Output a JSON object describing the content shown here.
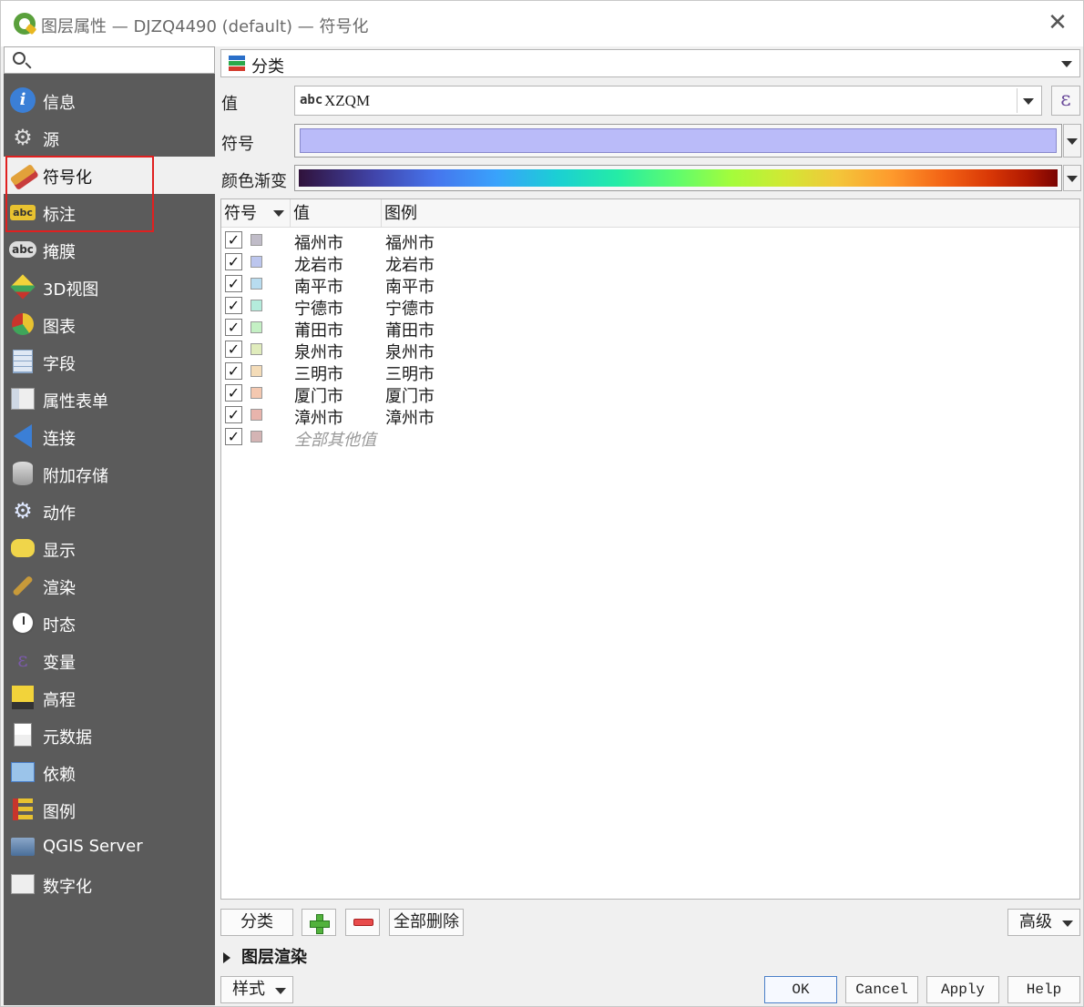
{
  "window": {
    "title": "图层属性 — DJZQ4490 (default) — 符号化",
    "close_glyph": "✕"
  },
  "search": {
    "placeholder": ""
  },
  "sidebar": {
    "items": [
      {
        "label": "信息",
        "icon": "info-icon",
        "selected": false
      },
      {
        "label": "源",
        "icon": "source-wrench-icon",
        "selected": false
      },
      {
        "label": "符号化",
        "icon": "symbology-brush-icon",
        "selected": true
      },
      {
        "label": "标注",
        "icon": "labels-abc-icon",
        "selected": false
      },
      {
        "label": "掩膜",
        "icon": "mask-abc-icon",
        "selected": false
      },
      {
        "label": "3D视图",
        "icon": "3d-cube-icon",
        "selected": false
      },
      {
        "label": "图表",
        "icon": "diagram-icon",
        "selected": false
      },
      {
        "label": "字段",
        "icon": "fields-icon",
        "selected": false
      },
      {
        "label": "属性表单",
        "icon": "attribute-form-icon",
        "selected": false
      },
      {
        "label": "连接",
        "icon": "joins-icon",
        "selected": false
      },
      {
        "label": "附加存储",
        "icon": "auxiliary-storage-icon",
        "selected": false
      },
      {
        "label": "动作",
        "icon": "actions-icon",
        "selected": false
      },
      {
        "label": "显示",
        "icon": "display-tip-icon",
        "selected": false
      },
      {
        "label": "渲染",
        "icon": "rendering-brush-icon",
        "selected": false
      },
      {
        "label": "时态",
        "icon": "temporal-clock-icon",
        "selected": false
      },
      {
        "label": "变量",
        "icon": "variables-epsilon-icon",
        "selected": false
      },
      {
        "label": "高程",
        "icon": "elevation-icon",
        "selected": false
      },
      {
        "label": "元数据",
        "icon": "metadata-icon",
        "selected": false
      },
      {
        "label": "依赖",
        "icon": "dependencies-icon",
        "selected": false
      },
      {
        "label": "图例",
        "icon": "legend-icon",
        "selected": false
      },
      {
        "label": "QGIS Server",
        "icon": "qgis-server-icon",
        "selected": false
      },
      {
        "label": "数字化",
        "icon": "digitizing-icon",
        "selected": false
      }
    ]
  },
  "renderer": {
    "label": "分类"
  },
  "value": {
    "label": "值",
    "type_prefix": "abc",
    "field": "XZQM",
    "expression_glyph": "ε"
  },
  "symbol": {
    "label": "符号",
    "color": "#babbf9"
  },
  "color_ramp": {
    "label": "颜色渐变"
  },
  "table": {
    "headers": {
      "symbol": "符号",
      "value": "值",
      "legend": "图例"
    },
    "check_glyph": "✓",
    "rows": [
      {
        "value": "福州市",
        "legend": "福州市",
        "color": "#c0bcc8",
        "checked": true
      },
      {
        "value": "龙岩市",
        "legend": "龙岩市",
        "color": "#bcc6ee",
        "checked": true
      },
      {
        "value": "南平市",
        "legend": "南平市",
        "color": "#b8dcf0",
        "checked": true
      },
      {
        "value": "宁德市",
        "legend": "宁德市",
        "color": "#b4ecdc",
        "checked": true
      },
      {
        "value": "莆田市",
        "legend": "莆田市",
        "color": "#c4f0c4",
        "checked": true
      },
      {
        "value": "泉州市",
        "legend": "泉州市",
        "color": "#e0ecbc",
        "checked": true
      },
      {
        "value": "三明市",
        "legend": "三明市",
        "color": "#f4dcb8",
        "checked": true
      },
      {
        "value": "厦门市",
        "legend": "厦门市",
        "color": "#f4c8b0",
        "checked": true
      },
      {
        "value": "漳州市",
        "legend": "漳州市",
        "color": "#e8b4ac",
        "checked": true
      },
      {
        "value": "全部其他值",
        "legend": "",
        "color": "#d4b4b4",
        "checked": true,
        "other": true
      }
    ]
  },
  "buttons": {
    "classify": "分类",
    "delete_all": "全部删除",
    "advanced": "高级",
    "style": "样式",
    "ok": "OK",
    "cancel": "Cancel",
    "apply": "Apply",
    "help": "Help"
  },
  "layer_rendering": {
    "label": "图层渲染"
  }
}
